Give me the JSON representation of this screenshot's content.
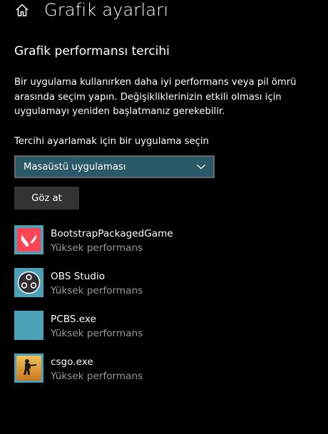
{
  "header": {
    "title": "Grafik ayarları",
    "home_icon": "home-icon"
  },
  "section": {
    "title": "Grafik performansı tercihi",
    "description": "Bir uygulama kullanırken daha iyi performans veya pil ömrü arasında seçim yapın. Değişikliklerinizin etkili olması için uygulamayı yeniden başlatmanız gerekebilir."
  },
  "selector": {
    "label": "Tercihi ayarlamak için bir uygulama seçin",
    "selected_value": "Masaüstü uygulaması",
    "chevron_icon": "chevron-down-icon"
  },
  "browse_button": {
    "label": "Göz at"
  },
  "apps": [
    {
      "name": "BootstrapPackagedGame",
      "status": "Yüksek performans",
      "icon": "valorant-icon"
    },
    {
      "name": "OBS Studio",
      "status": "Yüksek performans",
      "icon": "obs-icon"
    },
    {
      "name": "PCBS.exe",
      "status": "Yüksek performans",
      "icon": "generic-app-icon"
    },
    {
      "name": "csgo.exe",
      "status": "Yüksek performans",
      "icon": "csgo-icon"
    }
  ],
  "colors": {
    "background": "#000000",
    "dropdown_bg": "#2a5967",
    "accent_tile": "#4ba2b6",
    "button_bg": "#333333",
    "secondary_text": "#9a9a9a"
  }
}
